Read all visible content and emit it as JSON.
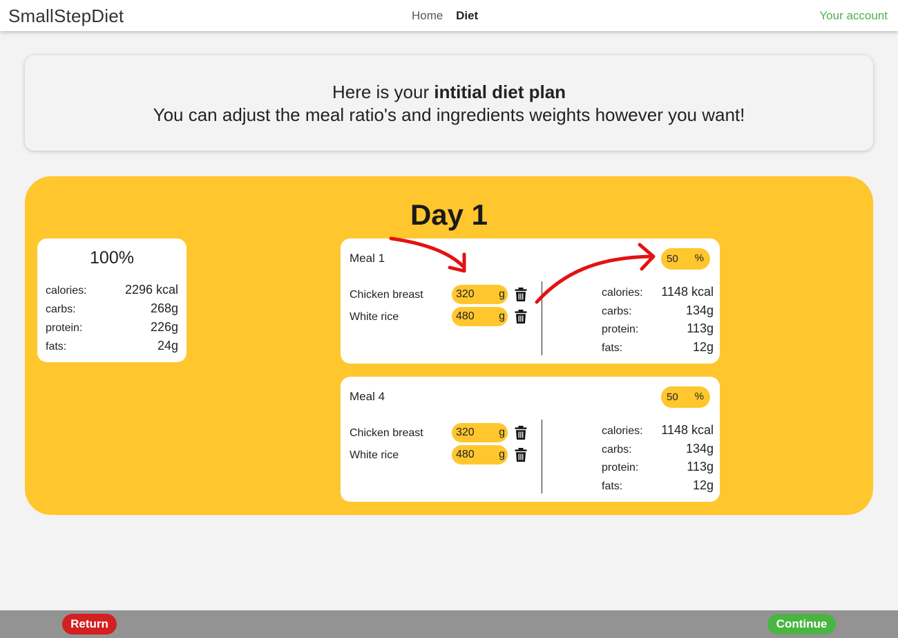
{
  "header": {
    "brand": "SmallStepDiet",
    "nav": [
      "Home",
      "Diet"
    ],
    "account": "Your account"
  },
  "intro": {
    "line1_prefix": "Here is your ",
    "line1_bold": "intitial diet plan",
    "line2": "You can adjust the meal ratio's and ingredients weights however you want!"
  },
  "day": {
    "title": "Day 1",
    "summary": {
      "percent": "100%",
      "calories_label": "calories:",
      "calories": "2296 kcal",
      "carbs_label": "carbs:",
      "carbs": "268g",
      "protein_label": "protein:",
      "protein": "226g",
      "fats_label": "fats:",
      "fats": "24g"
    },
    "meals": [
      {
        "name": "Meal 1",
        "ratio": "50",
        "ratio_unit": "%",
        "ingredients": [
          {
            "name": "Chicken breast",
            "weight": "320",
            "unit": "g"
          },
          {
            "name": "White rice",
            "weight": "480",
            "unit": "g"
          }
        ],
        "calories_label": "calories:",
        "calories": "1148 kcal",
        "carbs_label": "carbs:",
        "carbs": "134g",
        "protein_label": "protein:",
        "protein": "113g",
        "fats_label": "fats:",
        "fats": "12g"
      },
      {
        "name": "Meal 4",
        "ratio": "50",
        "ratio_unit": "%",
        "ingredients": [
          {
            "name": "Chicken breast",
            "weight": "320",
            "unit": "g"
          },
          {
            "name": "White rice",
            "weight": "480",
            "unit": "g"
          }
        ],
        "calories_label": "calories:",
        "calories": "1148 kcal",
        "carbs_label": "carbs:",
        "carbs": "134g",
        "protein_label": "protein:",
        "protein": "113g",
        "fats_label": "fats:",
        "fats": "12g"
      }
    ]
  },
  "footer": {
    "return_label": "Return",
    "continue_label": "Continue"
  },
  "colors": {
    "accent": "#ffc62e",
    "account": "#4caf50",
    "return": "#d32020",
    "continue": "#4bb543",
    "annotation_arrow": "#e31212"
  }
}
